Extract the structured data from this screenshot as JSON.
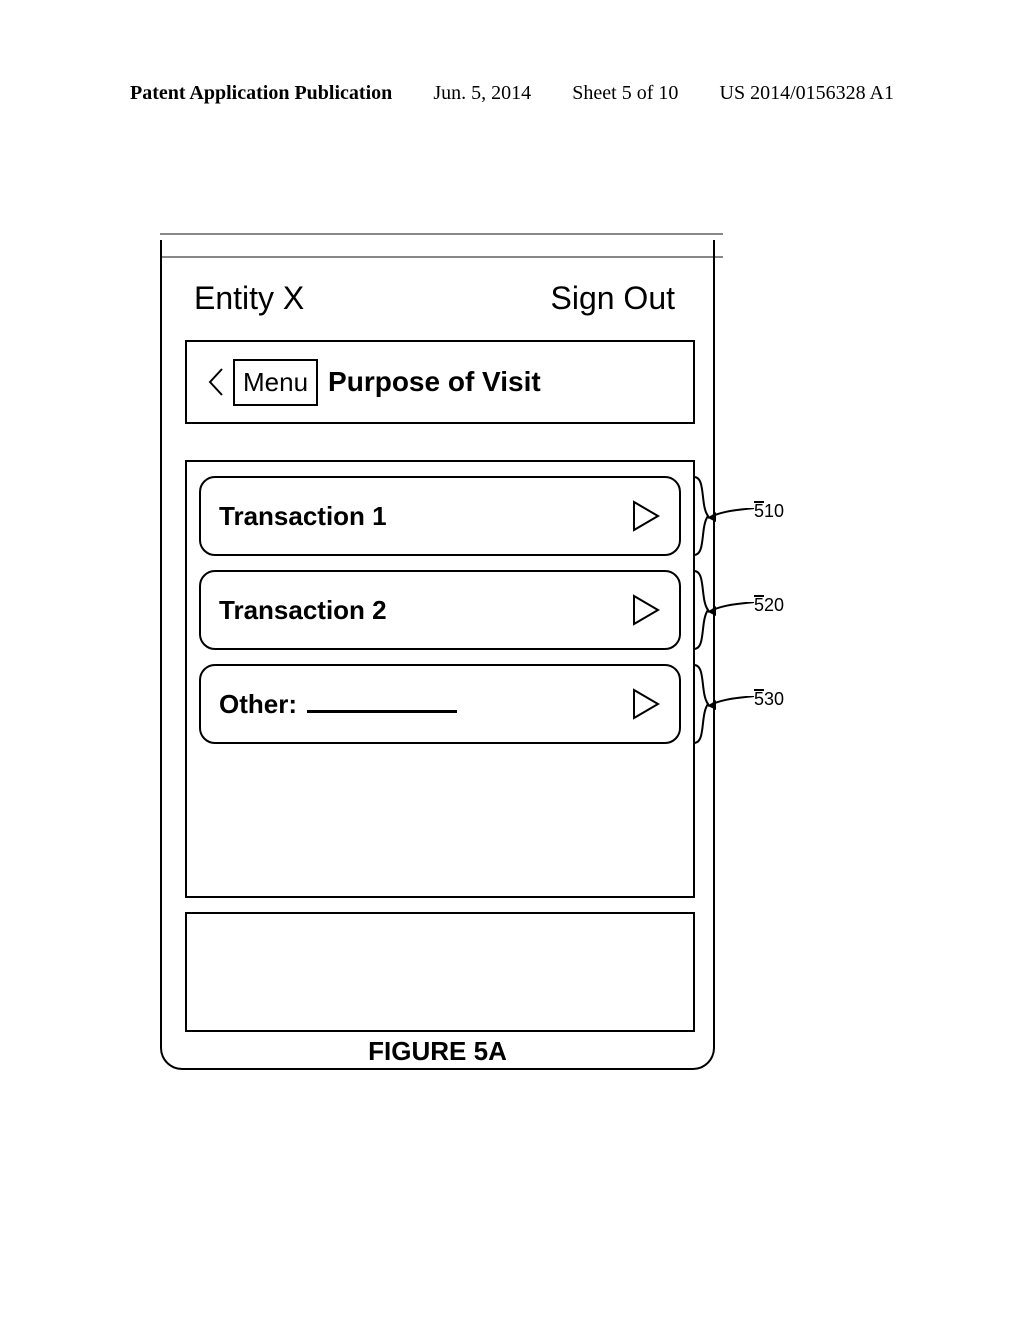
{
  "header": {
    "publication_type": "Patent Application Publication",
    "date": "Jun. 5, 2014",
    "sheet": "Sheet 5 of 10",
    "pub_number": "US 2014/0156328 A1"
  },
  "app": {
    "entity": "Entity X",
    "signout": "Sign Out",
    "menu_label": "Menu",
    "nav_title": "Purpose of Visit"
  },
  "rows": [
    {
      "label": "Transaction 1",
      "ref": "510"
    },
    {
      "label": "Transaction 2",
      "ref": "520"
    },
    {
      "label": "Other:",
      "ref": "530",
      "has_blank": true
    }
  ],
  "figure_caption": "FIGURE 5A"
}
